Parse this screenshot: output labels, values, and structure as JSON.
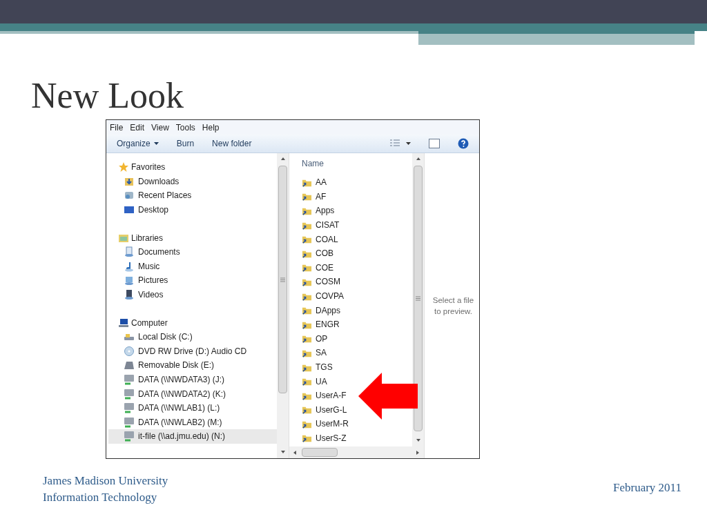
{
  "slide": {
    "title": "New Look",
    "footer_left": [
      "James Madison University",
      "Information Technology"
    ],
    "footer_right": "February 2011"
  },
  "explorer": {
    "menu": [
      "File",
      "Edit",
      "View",
      "Tools",
      "Help"
    ],
    "toolbar": [
      {
        "label": "Organize",
        "kind": "dropdown"
      },
      {
        "label": "Burn",
        "kind": "plain"
      },
      {
        "label": "New folder",
        "kind": "plain"
      }
    ],
    "nav": [
      {
        "label": "Favorites",
        "kind": "star",
        "selected": false,
        "children": [
          {
            "label": "Downloads",
            "kind": "downloads",
            "selected": false
          },
          {
            "label": "Recent Places",
            "kind": "recent",
            "selected": false
          },
          {
            "label": "Desktop",
            "kind": "desktop",
            "selected": false
          }
        ]
      },
      {
        "label": "Libraries",
        "kind": "library",
        "selected": false,
        "children": [
          {
            "label": "Documents",
            "kind": "documents",
            "selected": false
          },
          {
            "label": "Music",
            "kind": "music",
            "selected": false
          },
          {
            "label": "Pictures",
            "kind": "pictures",
            "selected": false
          },
          {
            "label": "Videos",
            "kind": "videos",
            "selected": false
          }
        ]
      },
      {
        "label": "Computer",
        "kind": "computer",
        "selected": false,
        "children": [
          {
            "label": "Local Disk (C:)",
            "kind": "disk",
            "selected": false
          },
          {
            "label": "DVD RW Drive (D:) Audio CD",
            "kind": "dvd",
            "selected": false
          },
          {
            "label": "Removable Disk (E:)",
            "kind": "removable",
            "selected": false
          },
          {
            "label": "DATA (\\\\NWDATA3) (J:)",
            "kind": "network",
            "selected": false
          },
          {
            "label": "DATA (\\\\NWDATA2) (K:)",
            "kind": "network",
            "selected": false
          },
          {
            "label": "DATA (\\\\NWLAB1) (L:)",
            "kind": "network",
            "selected": false
          },
          {
            "label": "DATA (\\\\NWLAB2) (M:)",
            "kind": "network",
            "selected": false
          },
          {
            "label": "it-file (\\\\ad.jmu.edu) (N:)",
            "kind": "network",
            "selected": true
          }
        ]
      }
    ],
    "column_header": "Name",
    "folders": [
      "AA",
      "AF",
      "Apps",
      "CISAT",
      "COAL",
      "COB",
      "COE",
      "COSM",
      "COVPA",
      "DApps",
      "ENGR",
      "OP",
      "SA",
      "TGS",
      "UA",
      "UserA-F",
      "UserG-L",
      "UserM-R",
      "UserS-Z"
    ],
    "preview_text": "Select a file to preview."
  }
}
